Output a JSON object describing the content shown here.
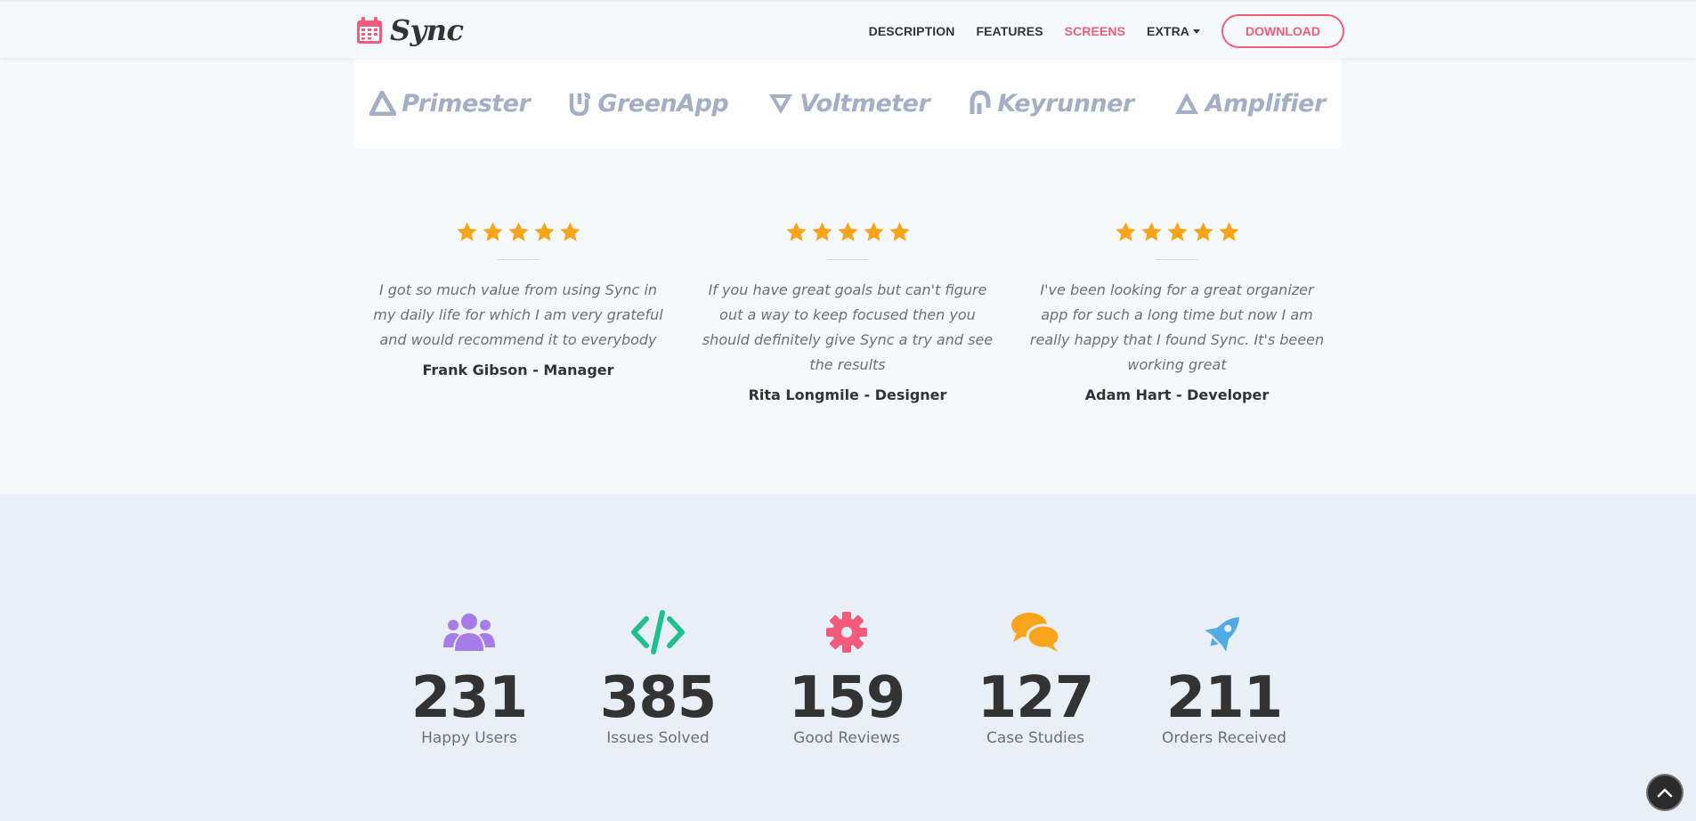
{
  "nav": {
    "brand": "Sync",
    "brand_icon": "calendar-icon",
    "links": [
      {
        "label": "DESCRIPTION",
        "active": false
      },
      {
        "label": "FEATURES",
        "active": false
      },
      {
        "label": "SCREENS",
        "active": true
      },
      {
        "label": "EXTRA",
        "active": false,
        "dropdown": true
      }
    ],
    "download_label": "DOWNLOAD",
    "accent_color": "#f25c7a"
  },
  "partners": [
    {
      "name": "Primester",
      "icon": "primester-logo-icon"
    },
    {
      "name": "GreenApp",
      "icon": "greenapp-logo-icon"
    },
    {
      "name": "Voltmeter",
      "icon": "voltmeter-logo-icon"
    },
    {
      "name": "Keyrunner",
      "icon": "keyrunner-logo-icon"
    },
    {
      "name": "Amplifier",
      "icon": "amplifier-logo-icon"
    }
  ],
  "testimonials": [
    {
      "rating": 5,
      "quote": "I got so much value from using Sync in my daily life for which I am very grateful and would recommend it to everybody",
      "author": "Frank Gibson - Manager"
    },
    {
      "rating": 5,
      "quote": "If you have great goals but can't figure out a way to keep focused then you should definitely give Sync a try and see the results",
      "author": "Rita Longmile - Designer"
    },
    {
      "rating": 5,
      "quote": "I've been looking for a great organizer app for such a long time but now I am really happy that I found Sync. It's beeen working great",
      "author": "Adam Hart - Developer"
    }
  ],
  "star_color": "#f9a51b",
  "stats": [
    {
      "number": "231",
      "label": "Happy Users",
      "icon": "users-icon",
      "color": "#a67de8"
    },
    {
      "number": "385",
      "label": "Issues Solved",
      "icon": "code-icon",
      "color": "#1fc08e"
    },
    {
      "number": "159",
      "label": "Good Reviews",
      "icon": "gear-icon",
      "color": "#f25c7a"
    },
    {
      "number": "127",
      "label": "Case Studies",
      "icon": "comments-icon",
      "color": "#f9a51b"
    },
    {
      "number": "211",
      "label": "Orders Received",
      "icon": "rocket-icon",
      "color": "#4eabe3"
    }
  ]
}
